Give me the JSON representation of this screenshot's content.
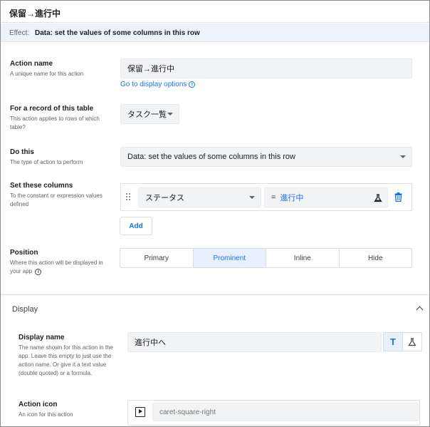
{
  "header": {
    "title": "保留→進行中"
  },
  "effect": {
    "label": "Effect:",
    "value": "Data: set the values of some columns in this row"
  },
  "action_name": {
    "label": "Action name",
    "description": "A unique name for this action",
    "value": "保留→進行中",
    "link": "Go to display options"
  },
  "record_table": {
    "label": "For a record of this table",
    "description": "This action applies to rows of which table?",
    "value": "タスク一覧"
  },
  "do_this": {
    "label": "Do this",
    "description": "The type of action to perform",
    "value": "Data: set the values of some columns in this row"
  },
  "set_columns": {
    "label": "Set these columns",
    "description": "To the constant or expression values defined",
    "column": "ステータス",
    "equals": "=",
    "expression": "進行中",
    "add_label": "Add"
  },
  "position": {
    "label": "Position",
    "description": "Where this action will be displayed in your app",
    "options": [
      "Primary",
      "Prominent",
      "Inline",
      "Hide"
    ],
    "selected": "Prominent"
  },
  "display": {
    "section_title": "Display",
    "display_name": {
      "label": "Display name",
      "description": "The name shown for this action in the app. Leave this empty to just use the action name. Or give it a text value (double quoted) or a formula.",
      "value": "進行中へ",
      "text_toggle": "T"
    },
    "action_icon": {
      "label": "Action icon",
      "description": "An icon for this action",
      "placeholder": "caret-square-right",
      "icon": "caret-square-right-icon"
    }
  },
  "colors": {
    "accent": "#1a73e8",
    "effect_bg": "#eef3fb",
    "selected_bg": "#e8f0fe",
    "delete": "#1a73e8"
  }
}
